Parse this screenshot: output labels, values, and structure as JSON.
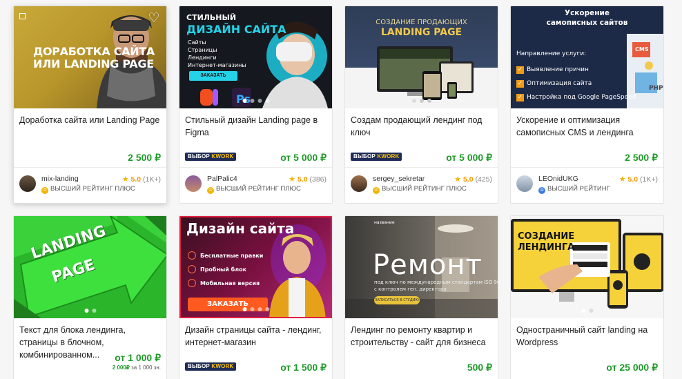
{
  "cards": [
    {
      "image": {
        "line1": "ДОРАБОТКА САЙТА",
        "line2": "ИЛИ LANDING PAGE"
      },
      "title": "Доработка сайта или Landing Page",
      "price": "2 500 ₽",
      "seller": {
        "name": "mix-landing",
        "rating": "5.0",
        "reviews": "(1K+)",
        "level": "ВЫСШИЙ РЕЙТИНГ ПЛЮС"
      }
    },
    {
      "image": {
        "line1": "СТИЛЬНЫЙ",
        "line2": "ДИЗАЙН САЙТА",
        "bullets": [
          "Сайты",
          "Страницы",
          "Лендинги",
          "Интернет-магазины"
        ],
        "button": "ЗАКАЗАТЬ"
      },
      "title": "Стильный дизайн Landing page в Figma",
      "badge": {
        "text": "ВЫБОР",
        "brand": "KWORK"
      },
      "price": "от 5 000 ₽",
      "seller": {
        "name": "PalPalic4",
        "rating": "5.0",
        "reviews": "(386)",
        "level": "ВЫСШИЙ РЕЙТИНГ ПЛЮС"
      }
    },
    {
      "image": {
        "line1": "СОЗДАНИЕ ПРОДАЮЩИХ",
        "line2": "LANDING PAGE"
      },
      "title": "Создам продающий лендинг под ключ",
      "badge": {
        "text": "ВЫБОР",
        "brand": "KWORK"
      },
      "price": "от 5 000 ₽",
      "seller": {
        "name": "sergey_sekretar",
        "rating": "5.0",
        "reviews": "(425)",
        "level": "ВЫСШИЙ РЕЙТИНГ ПЛЮС"
      }
    },
    {
      "image": {
        "line1": "Ускорение",
        "line2": "самописных сайтов",
        "subtitle": "Направление услуги:",
        "bullets": [
          "Выявление причин",
          "Оптимизация сайта",
          "Настройка под Google PageSpeed"
        ],
        "tag1": "CMS",
        "tag2": "PHP"
      },
      "title": "Ускорение и оптимизация самописных CMS и лендинга",
      "price": "2 500 ₽",
      "seller": {
        "name": "LEOnidUKG",
        "rating": "5.0",
        "reviews": "(1K+)",
        "level": "ВЫСШИЙ РЕЙТИНГ"
      }
    },
    {
      "image": {
        "line1": "LANDING",
        "line2": "PAGE"
      },
      "title": "Текст для блока лендинга, страницы в блочном, комбинированном...",
      "price": "от 1 000 ₽",
      "subprice": {
        "amount": "2 000₽",
        "rest": "за 1 000 зн."
      }
    },
    {
      "image": {
        "line1": "Дизайн сайта",
        "bullets": [
          "Бесплатные правки",
          "Пробный блок",
          "Мобильная версия"
        ],
        "button": "ЗАКАЗАТЬ"
      },
      "title": "Дизайн страницы сайта - лендинг, интернет-магазин",
      "badge": {
        "text": "ВЫБОР",
        "brand": "KWORK"
      },
      "price": "от 1 500 ₽"
    },
    {
      "image": {
        "small": "название",
        "line1": "Ремонт",
        "line2": "под ключ по международным стандартам ISO 9000",
        "line3": "с контролем ген. директора",
        "button": "ЗАПИСАТЬСЯ В СТУДИЮ"
      },
      "title": "Лендинг по ремонту квартир и строительству - сайт для бизнеса",
      "price": "500 ₽"
    },
    {
      "image": {
        "line1": "СОЗДАНИЕ",
        "line2": "ЛЕНДИНГА"
      },
      "title": "Одностраничный сайт landing на Wordpress",
      "price": "от 25 000 ₽"
    }
  ],
  "colors": {
    "price_green": "#1e9a28",
    "badge_navy": "#1f2d56",
    "star": "#f4b400"
  }
}
